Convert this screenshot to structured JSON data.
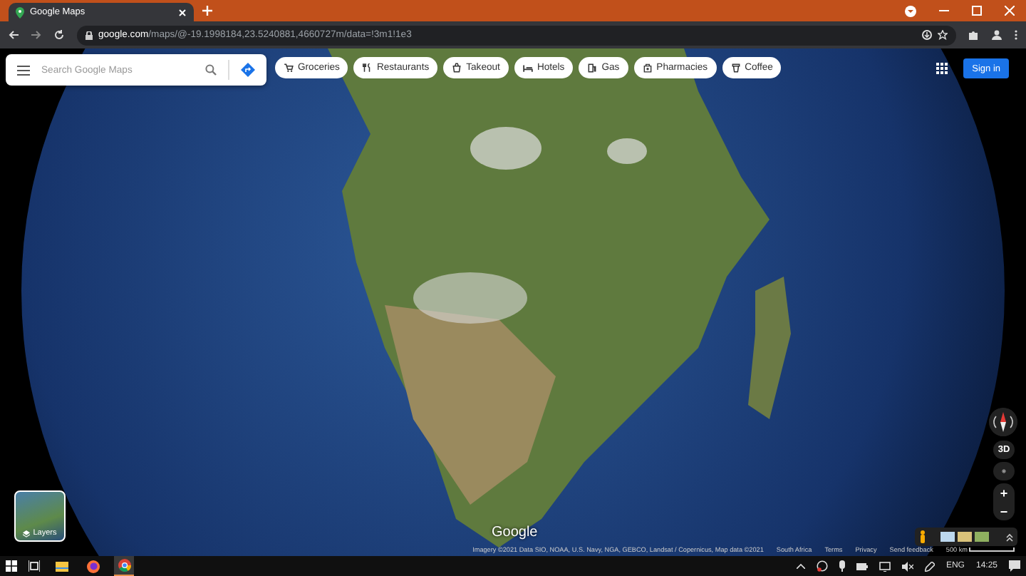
{
  "browser": {
    "tabs": [
      {
        "title": "Google Maps",
        "selected": true
      }
    ],
    "url_host": "google.com",
    "url_path": "/maps/@-19.1998184,23.5240881,4660727m/data=!3m1!1e3"
  },
  "search": {
    "placeholder": "Search Google Maps"
  },
  "chips": [
    {
      "label": "Groceries"
    },
    {
      "label": "Restaurants"
    },
    {
      "label": "Takeout"
    },
    {
      "label": "Hotels"
    },
    {
      "label": "Gas"
    },
    {
      "label": "Pharmacies"
    },
    {
      "label": "Coffee"
    }
  ],
  "sign_in": "Sign in",
  "layers": "Layers",
  "view_3d": "3D",
  "zoom_in": "+",
  "zoom_out": "−",
  "logo": "Google",
  "footer": {
    "imagery": "Imagery ©2021 Data SIO, NOAA, U.S. Navy, NGA, GEBCO, Landsat / Copernicus, Map data ©2021",
    "links": [
      "South Africa",
      "Terms",
      "Privacy",
      "Send feedback"
    ],
    "scale": "500 km"
  },
  "taskbar": {
    "apps": [
      {
        "selected": false
      },
      {
        "selected": false
      },
      {
        "selected": true
      }
    ],
    "language": "ENG",
    "time": "14:25"
  }
}
